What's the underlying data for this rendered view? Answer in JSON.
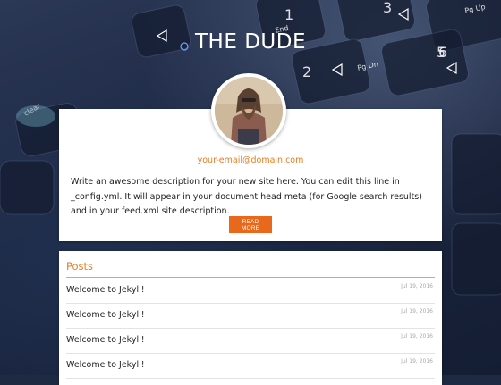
{
  "site": {
    "title": "THE DUDE",
    "email": "your-email@domain.com",
    "description": "Write an awesome description for your new site here. You can edit this line in _config.yml. It will appear in your document head meta (for Google search results) and in your feed.xml site description.",
    "read_more_label": "READ MORE"
  },
  "background": {
    "key_labels": [
      "1",
      "End",
      "2",
      "3",
      "Pg Dn",
      "5",
      "6",
      "Pg Up",
      "clear"
    ]
  },
  "posts": {
    "heading": "Posts",
    "items": [
      {
        "title": "Welcome to Jekyll!",
        "date": "Jul 19, 2016"
      },
      {
        "title": "Welcome to Jekyll!",
        "date": "Jul 19, 2016"
      },
      {
        "title": "Welcome to Jekyll!",
        "date": "Jul 19, 2016"
      },
      {
        "title": "Welcome to Jekyll!",
        "date": "Jul 19, 2016"
      }
    ]
  },
  "colors": {
    "accent": "#e67e22",
    "button": "#e8681c",
    "background": "#1e2a42"
  }
}
